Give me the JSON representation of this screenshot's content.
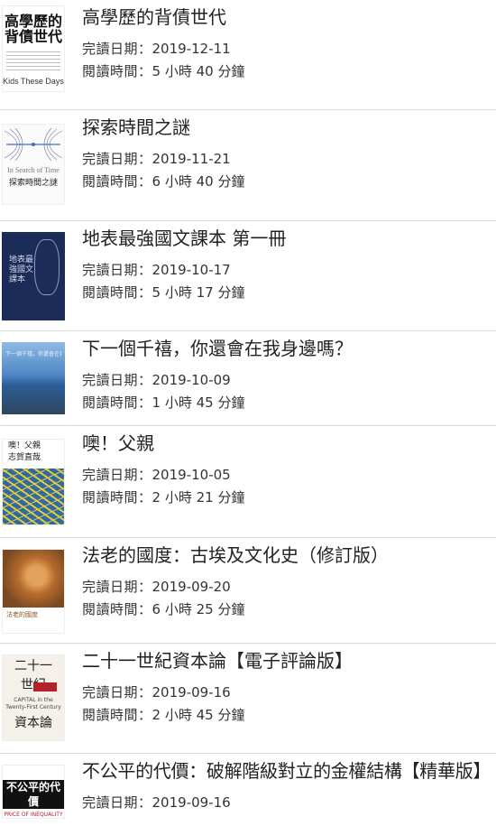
{
  "labels": {
    "completed_date": "完讀日期：",
    "reading_time": "閱讀時間："
  },
  "books": [
    {
      "title": "高學歷的背債世代",
      "completed_date": "2019-12-11",
      "reading_time": "5 小時 40 分鐘",
      "cover": {
        "title_line1": "高學歷的",
        "title_line2": "背債世代",
        "subtitle": "Kids These Days"
      }
    },
    {
      "title": "探索時間之謎",
      "completed_date": "2019-11-21",
      "reading_time": "6 小時 40 分鐘",
      "cover": {
        "title_en": "In Search of Time",
        "title_zh": "探索時間之謎"
      }
    },
    {
      "title": "地表最強國文課本 第一冊",
      "completed_date": "2019-10-17",
      "reading_time": "5 小時 17 分鐘",
      "cover": {
        "text": "地表最強國文課本"
      }
    },
    {
      "title": "下一個千禧，你還會在我身邊嗎？",
      "completed_date": "2019-10-09",
      "reading_time": "1 小時 45 分鐘",
      "cover": {
        "text": "下一個千禧，你還會在我身邊嗎？"
      }
    },
    {
      "title": "噢！父親",
      "completed_date": "2019-10-05",
      "reading_time": "2 小時 21 分鐘",
      "cover": {
        "title": "噢！父親",
        "author": "志賀直哉"
      }
    },
    {
      "title": "法老的國度：古埃及文化史（修訂版）",
      "completed_date": "2019-09-20",
      "reading_time": "6 小時 25 分鐘",
      "cover": {
        "title": "法老的國度"
      }
    },
    {
      "title": "二十一世紀資本論【電子評論版】",
      "completed_date": "2019-09-16",
      "reading_time": "2 小時 45 分鐘",
      "cover": {
        "line1": "二十一",
        "line2": "世紀",
        "line3": "資本論",
        "en": "CAPITAL in the Twenty-First Century"
      }
    },
    {
      "title": "不公平的代價：破解階級對立的金權結構【精華版】",
      "completed_date": "2019-09-16",
      "reading_time": "",
      "cover": {
        "title": "不公平的代價",
        "en": "PRICE OF INEQUALITY"
      }
    }
  ]
}
